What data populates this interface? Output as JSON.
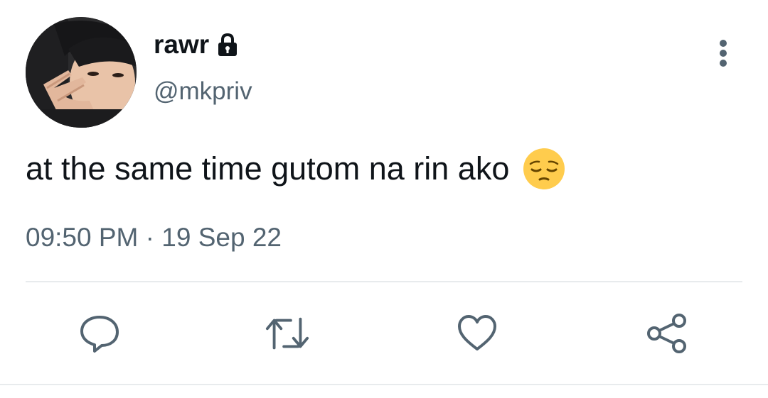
{
  "tweet": {
    "display_name": "rawr",
    "handle": "@mkpriv",
    "protected_icon": "lock-icon",
    "text": "at the same time gutom na rin ako",
    "emoji": "pensive-face",
    "time": "09:50 PM",
    "separator": "·",
    "date": "19 Sep 22"
  },
  "actions": [
    {
      "name": "reply",
      "icon": "comment-bubble-icon"
    },
    {
      "name": "retweet",
      "icon": "retweet-icon"
    },
    {
      "name": "like",
      "icon": "heart-icon"
    },
    {
      "name": "share",
      "icon": "share-icon"
    }
  ],
  "menu": {
    "icon": "more-vertical-icon"
  },
  "colors": {
    "text": "#0f1419",
    "secondary": "#536471",
    "divider": "#e8ebed",
    "emoji": "#ffcc4d"
  }
}
